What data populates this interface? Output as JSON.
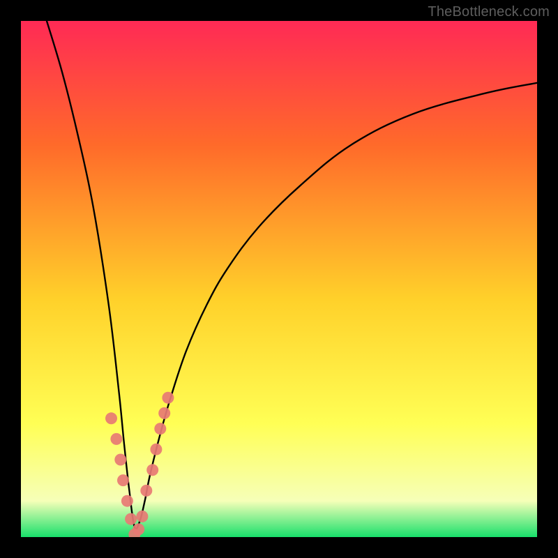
{
  "watermark": "TheBottleneck.com",
  "colors": {
    "frame": "#000000",
    "bg_top": "#ff2a55",
    "bg_mid1": "#ff6a2a",
    "bg_mid2": "#ffd12a",
    "bg_low1": "#ffff55",
    "bg_low2": "#f6ffb8",
    "bg_bottom": "#18e06b",
    "curve": "#000000",
    "point_fill": "#e77a74"
  },
  "chart_data": {
    "type": "line",
    "title": "",
    "xlabel": "",
    "ylabel": "",
    "xlim": [
      0,
      100
    ],
    "ylim": [
      0,
      100
    ],
    "grid": false,
    "notes": "V-shaped bottleneck curve; minimum near x≈22. Y axis inverted visually (0 at bottom = best).",
    "series": [
      {
        "name": "bottleneck-curve",
        "x": [
          5,
          8,
          11,
          14,
          17,
          19,
          20,
          21,
          22,
          23,
          24,
          25,
          27,
          29,
          32,
          36,
          40,
          46,
          54,
          64,
          76,
          90,
          100
        ],
        "y": [
          100,
          90,
          78,
          64,
          45,
          28,
          18,
          9,
          2,
          3,
          7,
          12,
          20,
          27,
          36,
          45,
          52,
          60,
          68,
          76,
          82,
          86,
          88
        ]
      }
    ],
    "points": {
      "name": "highlighted-points",
      "x": [
        17.5,
        18.5,
        19.3,
        19.8,
        20.6,
        21.3,
        22.0,
        22.8,
        23.5,
        24.3,
        25.5,
        26.2,
        27.0,
        27.8,
        28.5
      ],
      "y": [
        23.0,
        19.0,
        15.0,
        11.0,
        7.0,
        3.5,
        0.5,
        1.5,
        4.0,
        9.0,
        13.0,
        17.0,
        21.0,
        24.0,
        27.0
      ]
    }
  }
}
